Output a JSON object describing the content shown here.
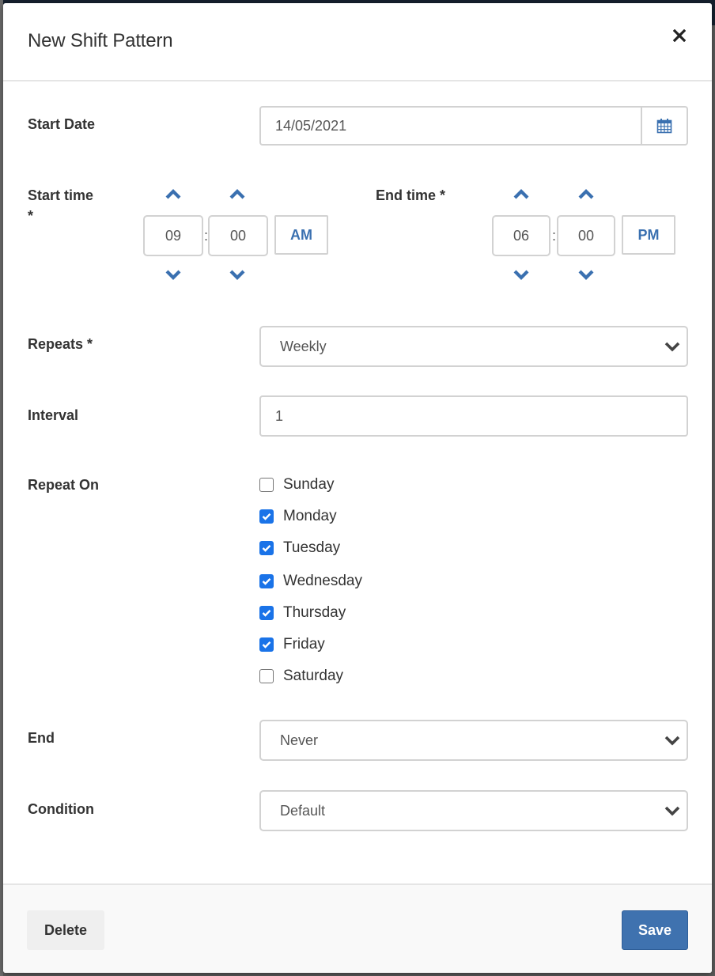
{
  "modal": {
    "title": "New Shift Pattern",
    "close_icon": "close-icon"
  },
  "form": {
    "start_date": {
      "label": "Start Date",
      "value": "14/05/2021",
      "icon": "calendar-icon"
    },
    "start_time": {
      "label": "Start time",
      "required_mark": "*",
      "hour": "09",
      "minute": "00",
      "separator": ":",
      "meridian": "AM"
    },
    "end_time": {
      "label": "End time *",
      "hour": "06",
      "minute": "00",
      "separator": ":",
      "meridian": "PM"
    },
    "repeats": {
      "label": "Repeats *",
      "value": "Weekly"
    },
    "interval": {
      "label": "Interval",
      "value": "1"
    },
    "repeat_on": {
      "label": "Repeat On",
      "days": [
        {
          "label": "Sunday",
          "checked": false
        },
        {
          "label": "Monday",
          "checked": true
        },
        {
          "label": "Tuesday",
          "checked": true
        },
        {
          "label": "Wednesday",
          "checked": true
        },
        {
          "label": "Thursday",
          "checked": true
        },
        {
          "label": "Friday",
          "checked": true
        },
        {
          "label": "Saturday",
          "checked": false
        }
      ]
    },
    "end": {
      "label": "End",
      "value": "Never"
    },
    "condition": {
      "label": "Condition",
      "value": "Default"
    }
  },
  "footer": {
    "delete_label": "Delete",
    "save_label": "Save"
  },
  "colors": {
    "accent": "#3f72af",
    "icon_blue": "#3a70b0",
    "checkbox_checked": "#1a73e8",
    "text": "#333333"
  }
}
